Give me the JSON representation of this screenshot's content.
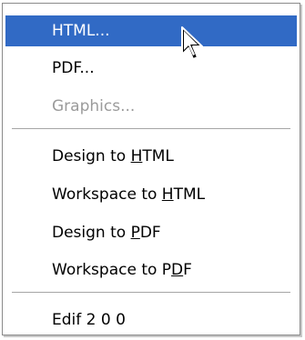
{
  "menu": {
    "items": [
      {
        "label": "HTML...",
        "state": "selected"
      },
      {
        "label": "PDF...",
        "state": "normal"
      },
      {
        "label": "Graphics...",
        "state": "disabled"
      }
    ],
    "export_items": [
      {
        "before": "Design to ",
        "mnemonic": "H",
        "after": "TML"
      },
      {
        "before": "Workspace to ",
        "mnemonic": "H",
        "after": "TML"
      },
      {
        "before": "Design to ",
        "mnemonic": "P",
        "after": "DF"
      },
      {
        "before": "Workspace to P",
        "mnemonic": "D",
        "after": "F"
      }
    ],
    "last_items": [
      {
        "label": "Edif 2 0 0"
      }
    ]
  },
  "colors": {
    "highlight": "#316ac5",
    "disabled_text": "#9b9b9b"
  },
  "cursor": {
    "icon": "arrow-pointer-icon"
  }
}
